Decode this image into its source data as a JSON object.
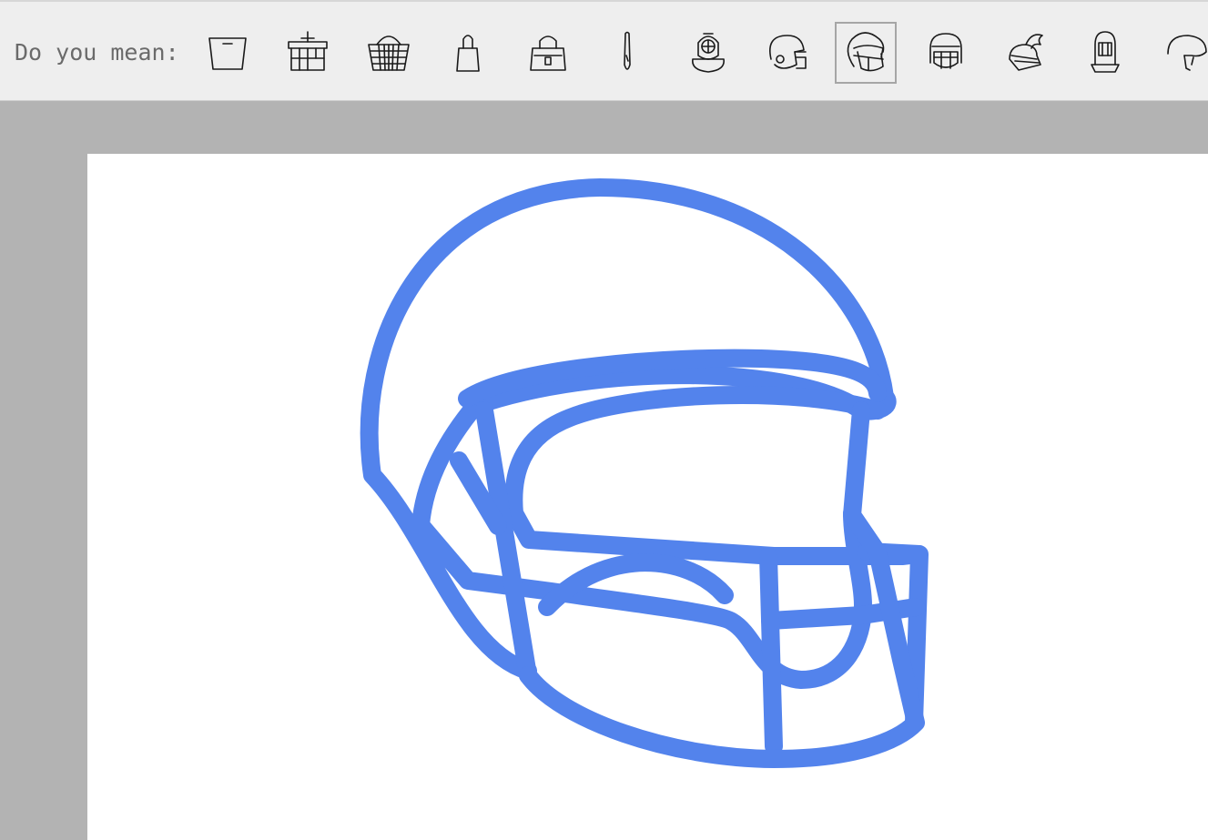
{
  "suggestion_bar": {
    "prompt": "Do you mean:",
    "items": [
      {
        "name": "bucket-bag-icon",
        "selected": false
      },
      {
        "name": "picnic-basket-icon",
        "selected": false
      },
      {
        "name": "wicker-basket-icon",
        "selected": false
      },
      {
        "name": "tote-bag-icon",
        "selected": false
      },
      {
        "name": "handbag-icon",
        "selected": false
      },
      {
        "name": "slim-bag-icon",
        "selected": false
      },
      {
        "name": "diving-helmet-icon",
        "selected": false
      },
      {
        "name": "football-helmet-side-icon",
        "selected": false
      },
      {
        "name": "football-helmet-icon",
        "selected": true
      },
      {
        "name": "football-helmet-front-icon",
        "selected": false
      },
      {
        "name": "plumed-knight-helmet-icon",
        "selected": false
      },
      {
        "name": "knight-helmet-icon",
        "selected": false
      },
      {
        "name": "bike-helmet-icon",
        "selected": false
      }
    ]
  },
  "drawing": {
    "stroke_color": "#5383ec",
    "subject": "football-helmet-sketch"
  },
  "colors": {
    "bar_background": "#eeeeee",
    "workspace_background": "#b3b3b3",
    "canvas_background": "#ffffff",
    "selection_border": "#a6a6a6"
  }
}
